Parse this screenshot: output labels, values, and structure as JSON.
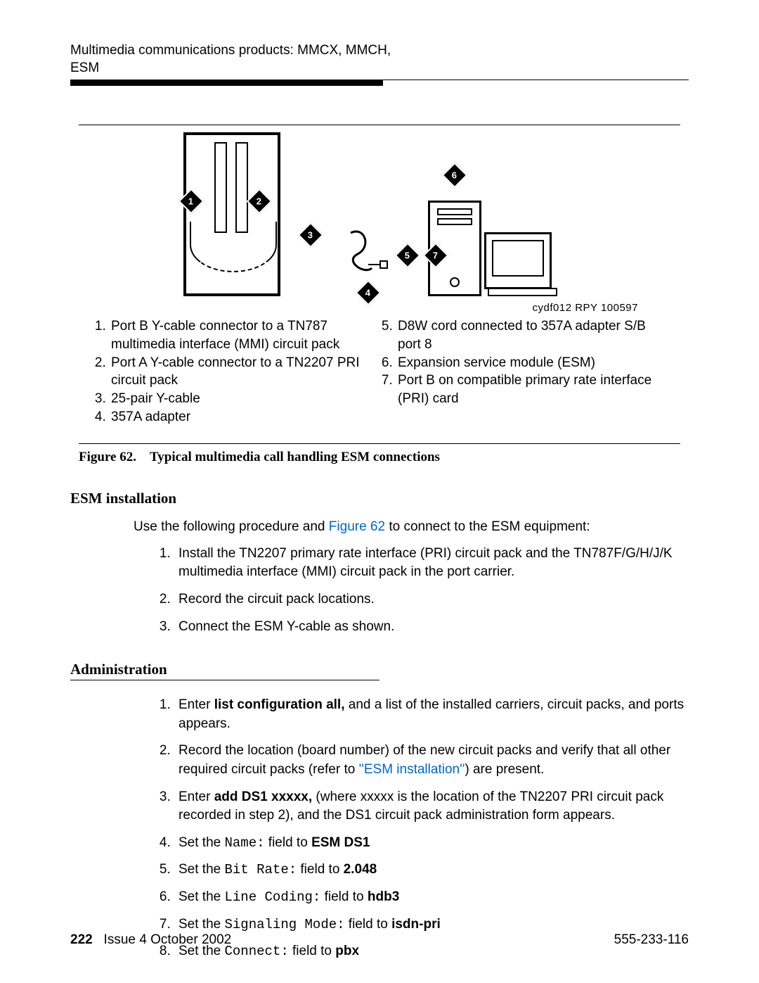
{
  "header": {
    "title_line1": "Multimedia communications products: MMCX, MMCH,",
    "title_line2": "ESM"
  },
  "figure": {
    "code": "cydf012 RPY 100597",
    "legend_left": [
      "Port B Y-cable connector to a TN787 multimedia interface (MMI) circuit pack",
      "Port A Y-cable connector to a TN2207 PRI circuit pack",
      "25-pair Y-cable",
      "357A adapter"
    ],
    "legend_right": [
      "D8W cord connected to 357A adapter S/B port 8",
      "Expansion service module (ESM)",
      "Port B on compatible primary rate interface (PRI) card"
    ],
    "caption_prefix": "Figure 62.",
    "caption_text": "Typical multimedia call handling ESM connections"
  },
  "sections": {
    "esm_heading": "ESM installation",
    "esm_intro_pre": "Use the following procedure and ",
    "esm_intro_link": "Figure 62",
    "esm_intro_post": " to connect to the ESM equipment:",
    "esm_steps": [
      "Install the TN2207 primary rate interface (PRI) circuit pack and the TN787F/G/H/J/K multimedia interface (MMI) circuit pack in the port carrier.",
      "Record the circuit pack locations.",
      "Connect the ESM Y-cable as shown."
    ],
    "admin_heading": "Administration",
    "admin": {
      "s1_pre": "Enter ",
      "s1_cmd": "list configuration all,",
      "s1_post": " and a list of the installed carriers, circuit packs, and ports appears.",
      "s2_pre": "Record the location (board number) of the new circuit packs and verify that all other required circuit packs (refer to ",
      "s2_link": "''ESM installation''",
      "s2_post": ") are present.",
      "s3_pre": "Enter ",
      "s3_cmd": "add DS1 xxxxx,",
      "s3_post": " (where xxxxx is the location of the TN2207 PRI circuit pack recorded in step 2), and the DS1 circuit pack administration form appears.",
      "s4_pre": "Set the ",
      "s4_field": "Name:",
      "s4_mid": " field to ",
      "s4_val": "ESM DS1",
      "s5_pre": "Set the ",
      "s5_field": "Bit Rate:",
      "s5_mid": " field to ",
      "s5_val": "2.048",
      "s6_pre": "Set the ",
      "s6_field": "Line Coding:",
      "s6_mid": " field to ",
      "s6_val": "hdb3",
      "s7_pre": "Set the ",
      "s7_field": "Signaling Mode:",
      "s7_mid": " field to ",
      "s7_val": "isdn-pri",
      "s8_pre": "Set the ",
      "s8_field": "Connect:",
      "s8_mid": " field to ",
      "s8_val": "pbx"
    }
  },
  "footer": {
    "page_num": "222",
    "issue": "Issue 4   October 2002",
    "doc_num": "555-233-116"
  }
}
